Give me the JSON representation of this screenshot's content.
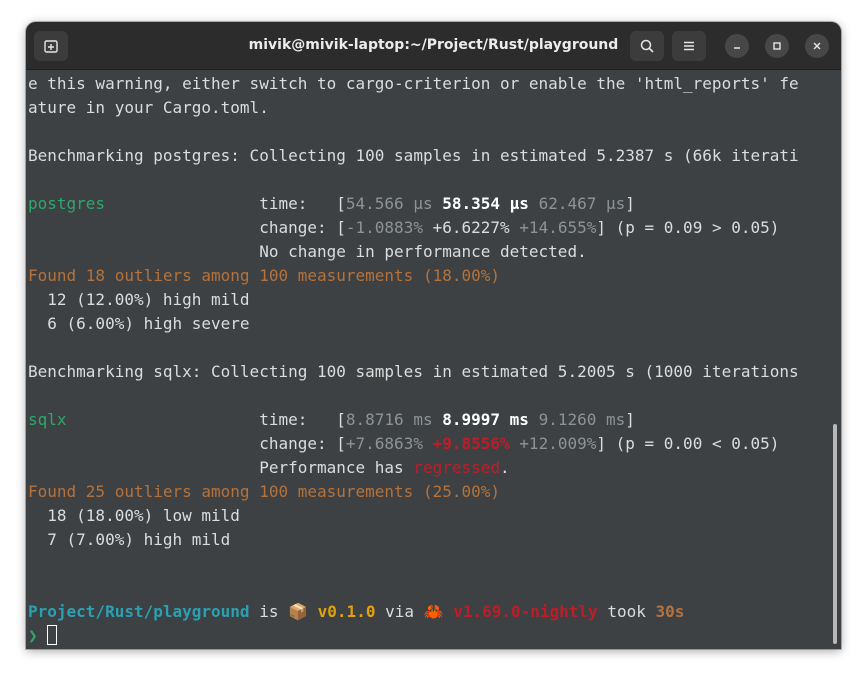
{
  "window": {
    "title": "mivik@mivik-laptop:~/Project/Rust/playground"
  },
  "icons": {
    "new_tab": "new-tab-icon",
    "search": "search-icon",
    "menu": "hamburger-menu-icon",
    "minimize": "minimize-icon",
    "maximize": "maximize-icon",
    "close": "close-icon",
    "package": "package-icon",
    "crab": "crab-icon"
  },
  "terminal": {
    "l1": "e this warning, either switch to cargo-criterion or enable the 'html_reports' fe",
    "l2": "ature in your Cargo.toml.",
    "pg_bench": "Benchmarking postgres: Collecting 100 samples in estimated 5.2387 s (66k iterati",
    "pg": {
      "name": "postgres",
      "pad": "                ",
      "time_label": "time:   [",
      "time_low": "54.566 µs",
      "time_mid": "58.354 µs",
      "time_high": "62.467 µs",
      "close_bracket": "]",
      "indent": "                        ",
      "change_label": "change: [",
      "change_low": "-1.0883%",
      "change_mid": "+6.6227%",
      "change_high": "+14.655%",
      "change_tail": "] (p = 0.09 > 0.05)",
      "verdict": "No change in performance detected.",
      "outliers": "Found 18 outliers among 100 measurements (18.00%)",
      "o1": "  12 (12.00%) high mild",
      "o2": "  6 (6.00%) high severe"
    },
    "sqlx_bench": "Benchmarking sqlx: Collecting 100 samples in estimated 5.2005 s (1000 iterations",
    "sqlx": {
      "name": "sqlx",
      "pad": "                    ",
      "time_label": "time:   [",
      "time_low": "8.8716 ms",
      "time_mid": "8.9997 ms",
      "time_high": "9.1260 ms",
      "close_bracket": "]",
      "indent": "                        ",
      "change_label": "change: [",
      "change_low": "+7.6863%",
      "change_mid": "+9.8556%",
      "change_high": "+12.009%",
      "change_tail": "] (p = 0.00 < 0.05)",
      "verdict_prefix": "Performance has ",
      "verdict_word": "regressed",
      "verdict_suffix": ".",
      "outliers": "Found 25 outliers among 100 measurements (25.00%)",
      "o1": "  18 (18.00%) low mild",
      "o2": "  7 (7.00%) high mild"
    },
    "prompt": {
      "dir": "Project/Rust/playground",
      "is": " is ",
      "pkg_glyph": "📦",
      "pkg_version": "v0.1.0",
      "via": " via ",
      "crab_glyph": "🦀",
      "rust_version": "v1.69.0-nightly",
      "took": " took ",
      "duration": "30s",
      "symbol": "❯"
    }
  },
  "colors": {
    "terminal_bg": "#3d4143",
    "titlebar_bg": "#2c2c2c",
    "green": "#2fa76c",
    "orange": "#b5723b",
    "red": "#c01c28",
    "cyan": "#2aa1b3",
    "yellow": "#e0a10d"
  }
}
